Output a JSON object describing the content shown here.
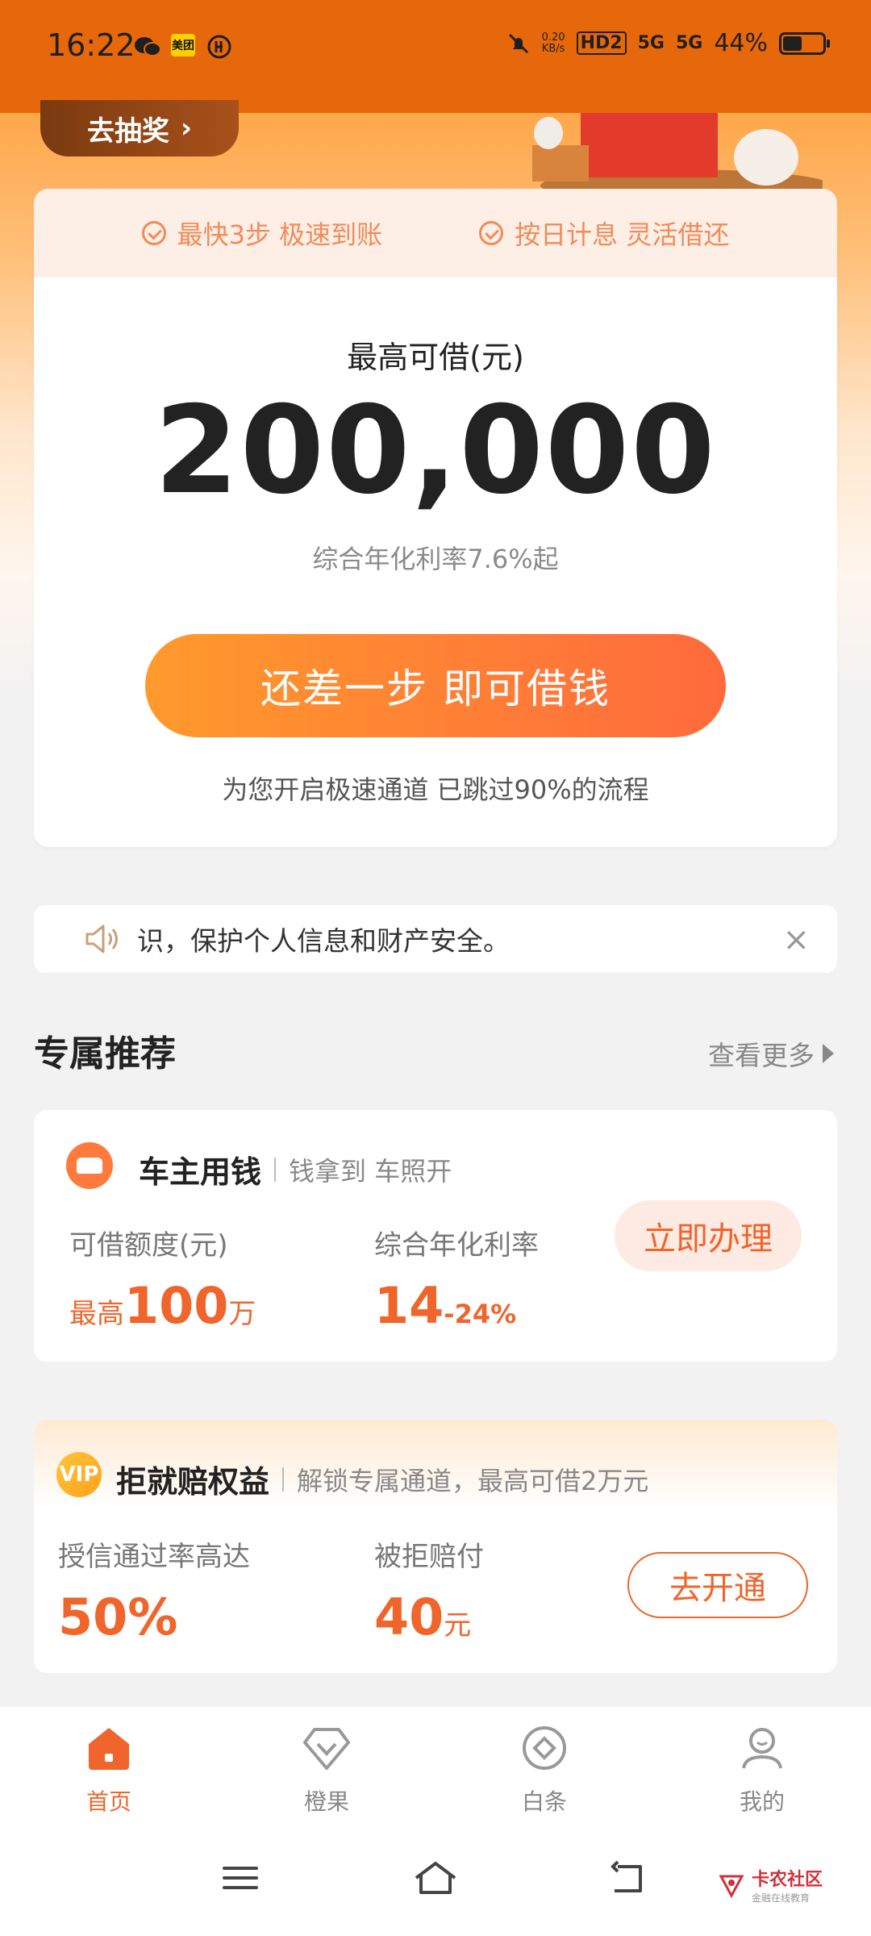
{
  "status_bar": {
    "time": "16:22",
    "net_speed": "0.20\nKB/s",
    "net_speed_top": "0.20",
    "net_speed_bottom": "KB/s",
    "hd": "HD2",
    "signal1": "5G",
    "signal2": "5G",
    "battery": "44%",
    "icons": [
      "wechat-icon",
      "meituan-icon",
      "app-icon",
      "mute-icon",
      "hd-icon",
      "signal-icon",
      "battery-icon"
    ],
    "meituan_label": "美团"
  },
  "hero": {
    "lottery_label": "去抽奖",
    "features": [
      "最快3步 极速到账",
      "按日计息 灵活借还"
    ],
    "max_label": "最高可借(元)",
    "max_amount": "200,000",
    "rate_line": "综合年化利率7.6%起",
    "cta": "还差一步 即可借钱",
    "skip_note": "为您开启极速通道 已跳过90%的流程"
  },
  "notice": {
    "text": "识，保护个人信息和财产安全。"
  },
  "section": {
    "title": "专属推荐",
    "more": "查看更多"
  },
  "products": [
    {
      "title": "车主用钱",
      "subtitle": "钱拿到 车照开",
      "label1": "可借额度(元)",
      "value1_prefix": "最高",
      "value1_number": "100",
      "value1_unit": "万",
      "label2": "综合年化利率",
      "value2_number": "14",
      "value2_suffix": "-24%",
      "button": "立即办理"
    },
    {
      "title": "拒就赔权益",
      "subtitle": "解锁专属通道，最高可借2万元",
      "label1": "授信通过率高达",
      "value1_number": "50%",
      "label2": "被拒赔付",
      "value2_number": "40",
      "value2_unit": "元",
      "button": "去开通",
      "icon_text": "VIP"
    }
  ],
  "bottom_nav": [
    {
      "label": "首页",
      "active": true
    },
    {
      "label": "橙果",
      "active": false
    },
    {
      "label": "白条",
      "active": false
    },
    {
      "label": "我的",
      "active": false
    }
  ],
  "watermark": {
    "title": "卡农社区",
    "sub": "金融在线教育"
  },
  "colors": {
    "status_bar": "#e7680a",
    "accent": "#f0652b",
    "cta_start": "#ff9a2c",
    "cta_end": "#ff6a3d"
  }
}
